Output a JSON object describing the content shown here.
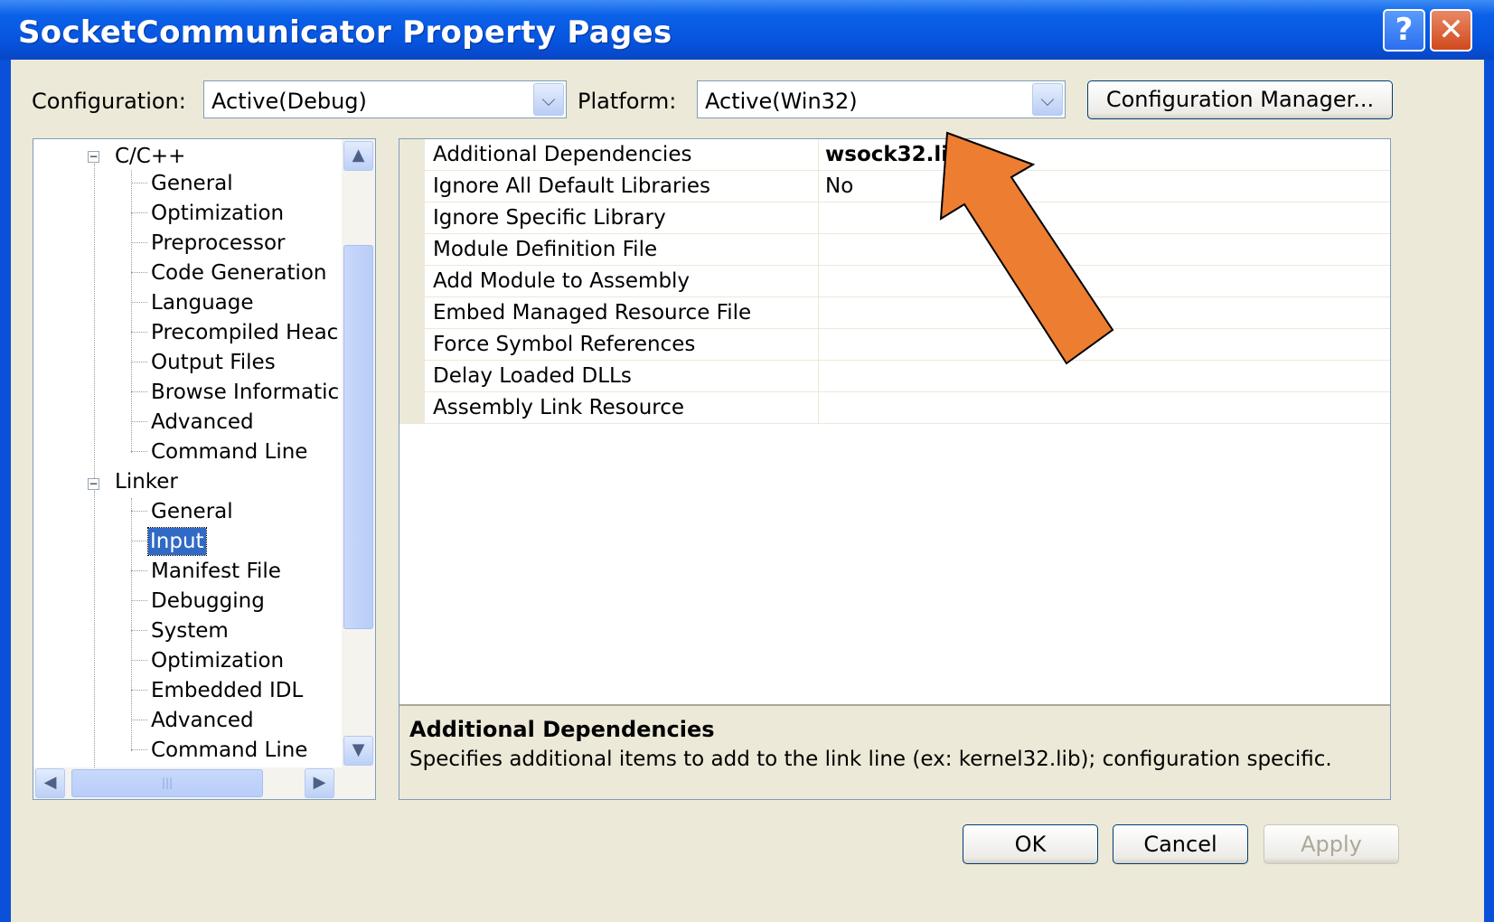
{
  "window": {
    "title": "SocketCommunicator Property Pages",
    "help_glyph": "?",
    "close_glyph": "✕"
  },
  "toolbar": {
    "configuration_label": "Configuration:",
    "configuration_value": "Active(Debug)",
    "platform_label": "Platform:",
    "platform_value": "Active(Win32)",
    "config_manager_label": "Configuration Manager..."
  },
  "tree": {
    "cpp_group": {
      "label": "C/C++",
      "items": [
        "General",
        "Optimization",
        "Preprocessor",
        "Code Generation",
        "Language",
        "Precompiled Heac",
        "Output Files",
        "Browse Informatic",
        "Advanced",
        "Command Line"
      ]
    },
    "linker_group": {
      "label": "Linker",
      "items": [
        "General",
        "Input",
        "Manifest File",
        "Debugging",
        "System",
        "Optimization",
        "Embedded IDL",
        "Advanced",
        "Command Line"
      ],
      "selected": "Input"
    }
  },
  "properties": [
    {
      "name": "Additional Dependencies",
      "value": "wsock32.lib"
    },
    {
      "name": "Ignore All Default Libraries",
      "value": "No"
    },
    {
      "name": "Ignore Specific Library",
      "value": ""
    },
    {
      "name": "Module Definition File",
      "value": ""
    },
    {
      "name": "Add Module to Assembly",
      "value": ""
    },
    {
      "name": "Embed Managed Resource File",
      "value": ""
    },
    {
      "name": "Force Symbol References",
      "value": ""
    },
    {
      "name": "Delay Loaded DLLs",
      "value": ""
    },
    {
      "name": "Assembly Link Resource",
      "value": ""
    }
  ],
  "description": {
    "title": "Additional Dependencies",
    "text": "Specifies additional items to add to the link line (ex: kernel32.lib); configuration specific."
  },
  "buttons": {
    "ok": "OK",
    "cancel": "Cancel",
    "apply": "Apply"
  },
  "annotation": {
    "arrow_color": "#ed7d31"
  },
  "colors": {
    "title_bar": "#0654df",
    "dialog_face": "#ece9d8",
    "selection": "#316ac5"
  }
}
